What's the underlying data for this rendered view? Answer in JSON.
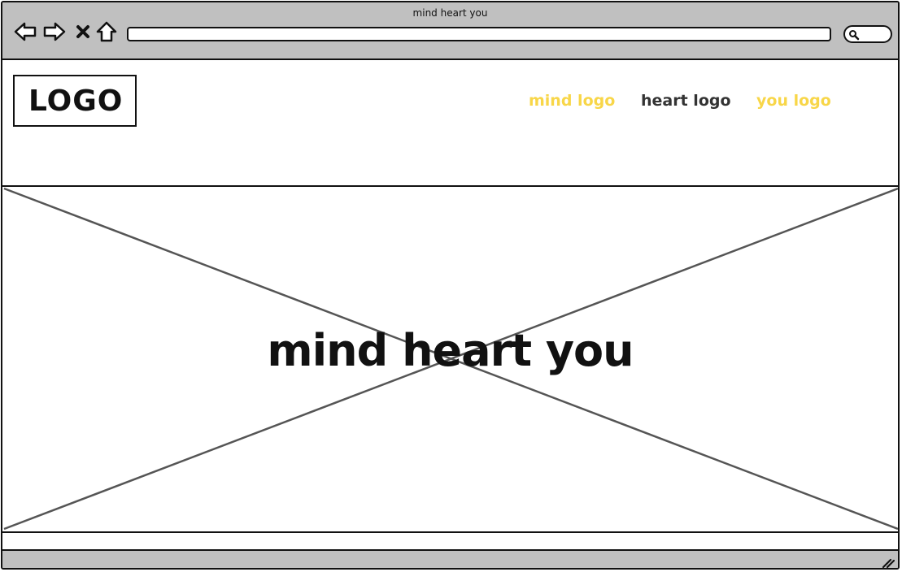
{
  "window": {
    "title": "mind heart you"
  },
  "toolbar": {
    "back_icon": "back-arrow-icon",
    "forward_icon": "forward-arrow-icon",
    "stop_icon": "close-icon",
    "home_icon": "home-icon",
    "address": "",
    "search_icon": "search-icon"
  },
  "header": {
    "logo": "LOGO",
    "nav": [
      {
        "label": "mind logo",
        "color": "#f8d648"
      },
      {
        "label": "heart logo",
        "color": "#333333"
      },
      {
        "label": "you logo",
        "color": "#f8d648"
      }
    ]
  },
  "hero": {
    "title": "mind heart you"
  },
  "colors": {
    "chrome": "#c0c0c0",
    "accent": "#f8d648",
    "ink": "#111111"
  }
}
